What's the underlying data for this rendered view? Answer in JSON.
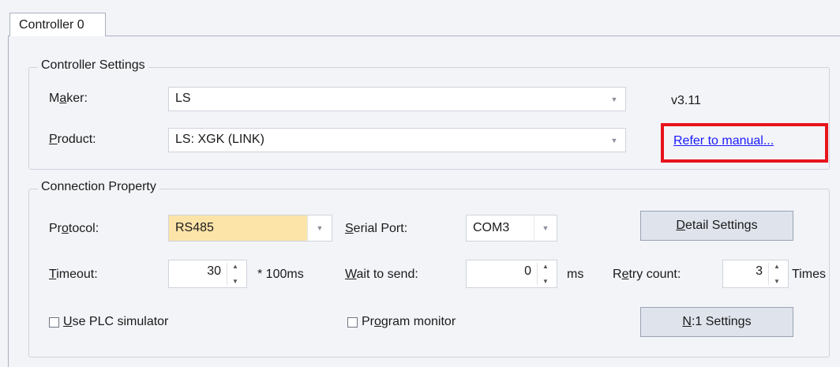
{
  "tab": {
    "label": "Controller 0"
  },
  "controller_settings": {
    "title": "Controller Settings",
    "maker_label": "Maker:",
    "maker_value": "LS",
    "product_label": "Product:",
    "product_value": "LS: XGK (LINK)",
    "version": "v3.11",
    "manual_link": "Refer to manual..."
  },
  "connection": {
    "title": "Connection Property",
    "protocol_label": "Protocol:",
    "protocol_value": "RS485",
    "serial_port_label": "Serial Port:",
    "serial_port_value": "COM3",
    "detail_button": "Detail Settings",
    "timeout_label": "Timeout:",
    "timeout_value": "30",
    "timeout_unit": "* 100ms",
    "wait_label": "Wait to send:",
    "wait_value": "0",
    "wait_unit": "ms",
    "retry_label": "Retry count:",
    "retry_value": "3",
    "retry_unit": "Times",
    "use_plc_simulator": "Use PLC simulator",
    "program_monitor": "Program monitor",
    "n1_button": "N:1 Settings"
  },
  "colors": {
    "highlight": "#fce4a9",
    "annotation_box": "#e8131b",
    "link": "#1a1aff"
  }
}
